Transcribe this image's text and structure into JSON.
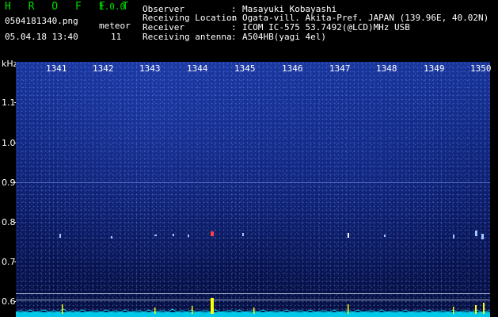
{
  "header": {
    "brand": "H R O F F T",
    "version": "1.0.0",
    "filename": "0504181340.png",
    "datetime": "05.04.18 13:40",
    "meteor_label": "meteor",
    "meteor_count": "11"
  },
  "info": {
    "rows": [
      {
        "label": "Observer",
        "value": "Masayuki Kobayashi"
      },
      {
        "label": "Receiving Location",
        "value": "Ogata-vill. Akita-Pref. JAPAN (139.96E, 40.02N)"
      },
      {
        "label": "Receiver",
        "value": "ICOM IC-575 53.7492(@LCD)MHz USB"
      },
      {
        "label": "Receiving antenna",
        "value": "A504HB(yagi 4el)"
      }
    ],
    "separator": ":"
  },
  "axes": {
    "y_unit": "kHz",
    "y_ticks": [
      "1.1",
      "1.0",
      "0.9",
      "0.8",
      "0.7",
      "0.6"
    ],
    "x_ticks": [
      "1341",
      "1342",
      "1343",
      "1344",
      "1345",
      "1346",
      "1347",
      "1348",
      "1349",
      "1350"
    ]
  },
  "colors": {
    "brand": "#00e000",
    "text": "#ffffff",
    "spectrum": "#00e5ff",
    "meteor": "#ffff00",
    "echo": "#ff4040"
  },
  "events": {
    "meteor_echo_minute": 1344.5,
    "meteor_echo_freq_khz": 0.765
  }
}
